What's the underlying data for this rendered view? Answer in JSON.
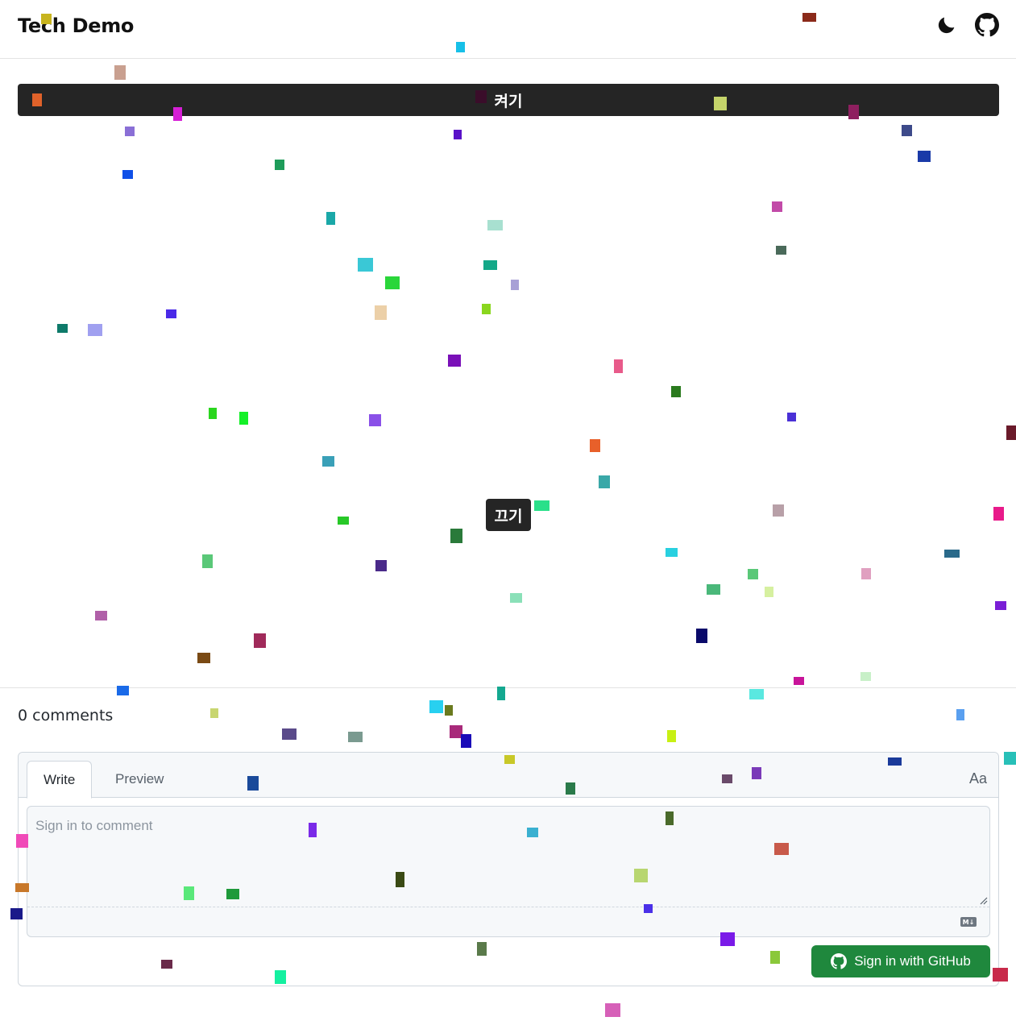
{
  "header": {
    "title": "Tech Demo",
    "theme_icon": "moon-icon",
    "repo_icon": "github-icon"
  },
  "demo": {
    "on_label": "켜기",
    "off_label": "끄기"
  },
  "comments": {
    "count_text": "0 comments",
    "tabs": {
      "write": "Write",
      "preview": "Preview"
    },
    "format_toggle": "Aa",
    "placeholder": "Sign in to comment",
    "markdown_badge": "M↓",
    "signin_label": "Sign in with GitHub",
    "signin_icon": "github-icon"
  },
  "colors": {
    "accent_dark": "#252525",
    "signin_green": "#1f883d"
  }
}
